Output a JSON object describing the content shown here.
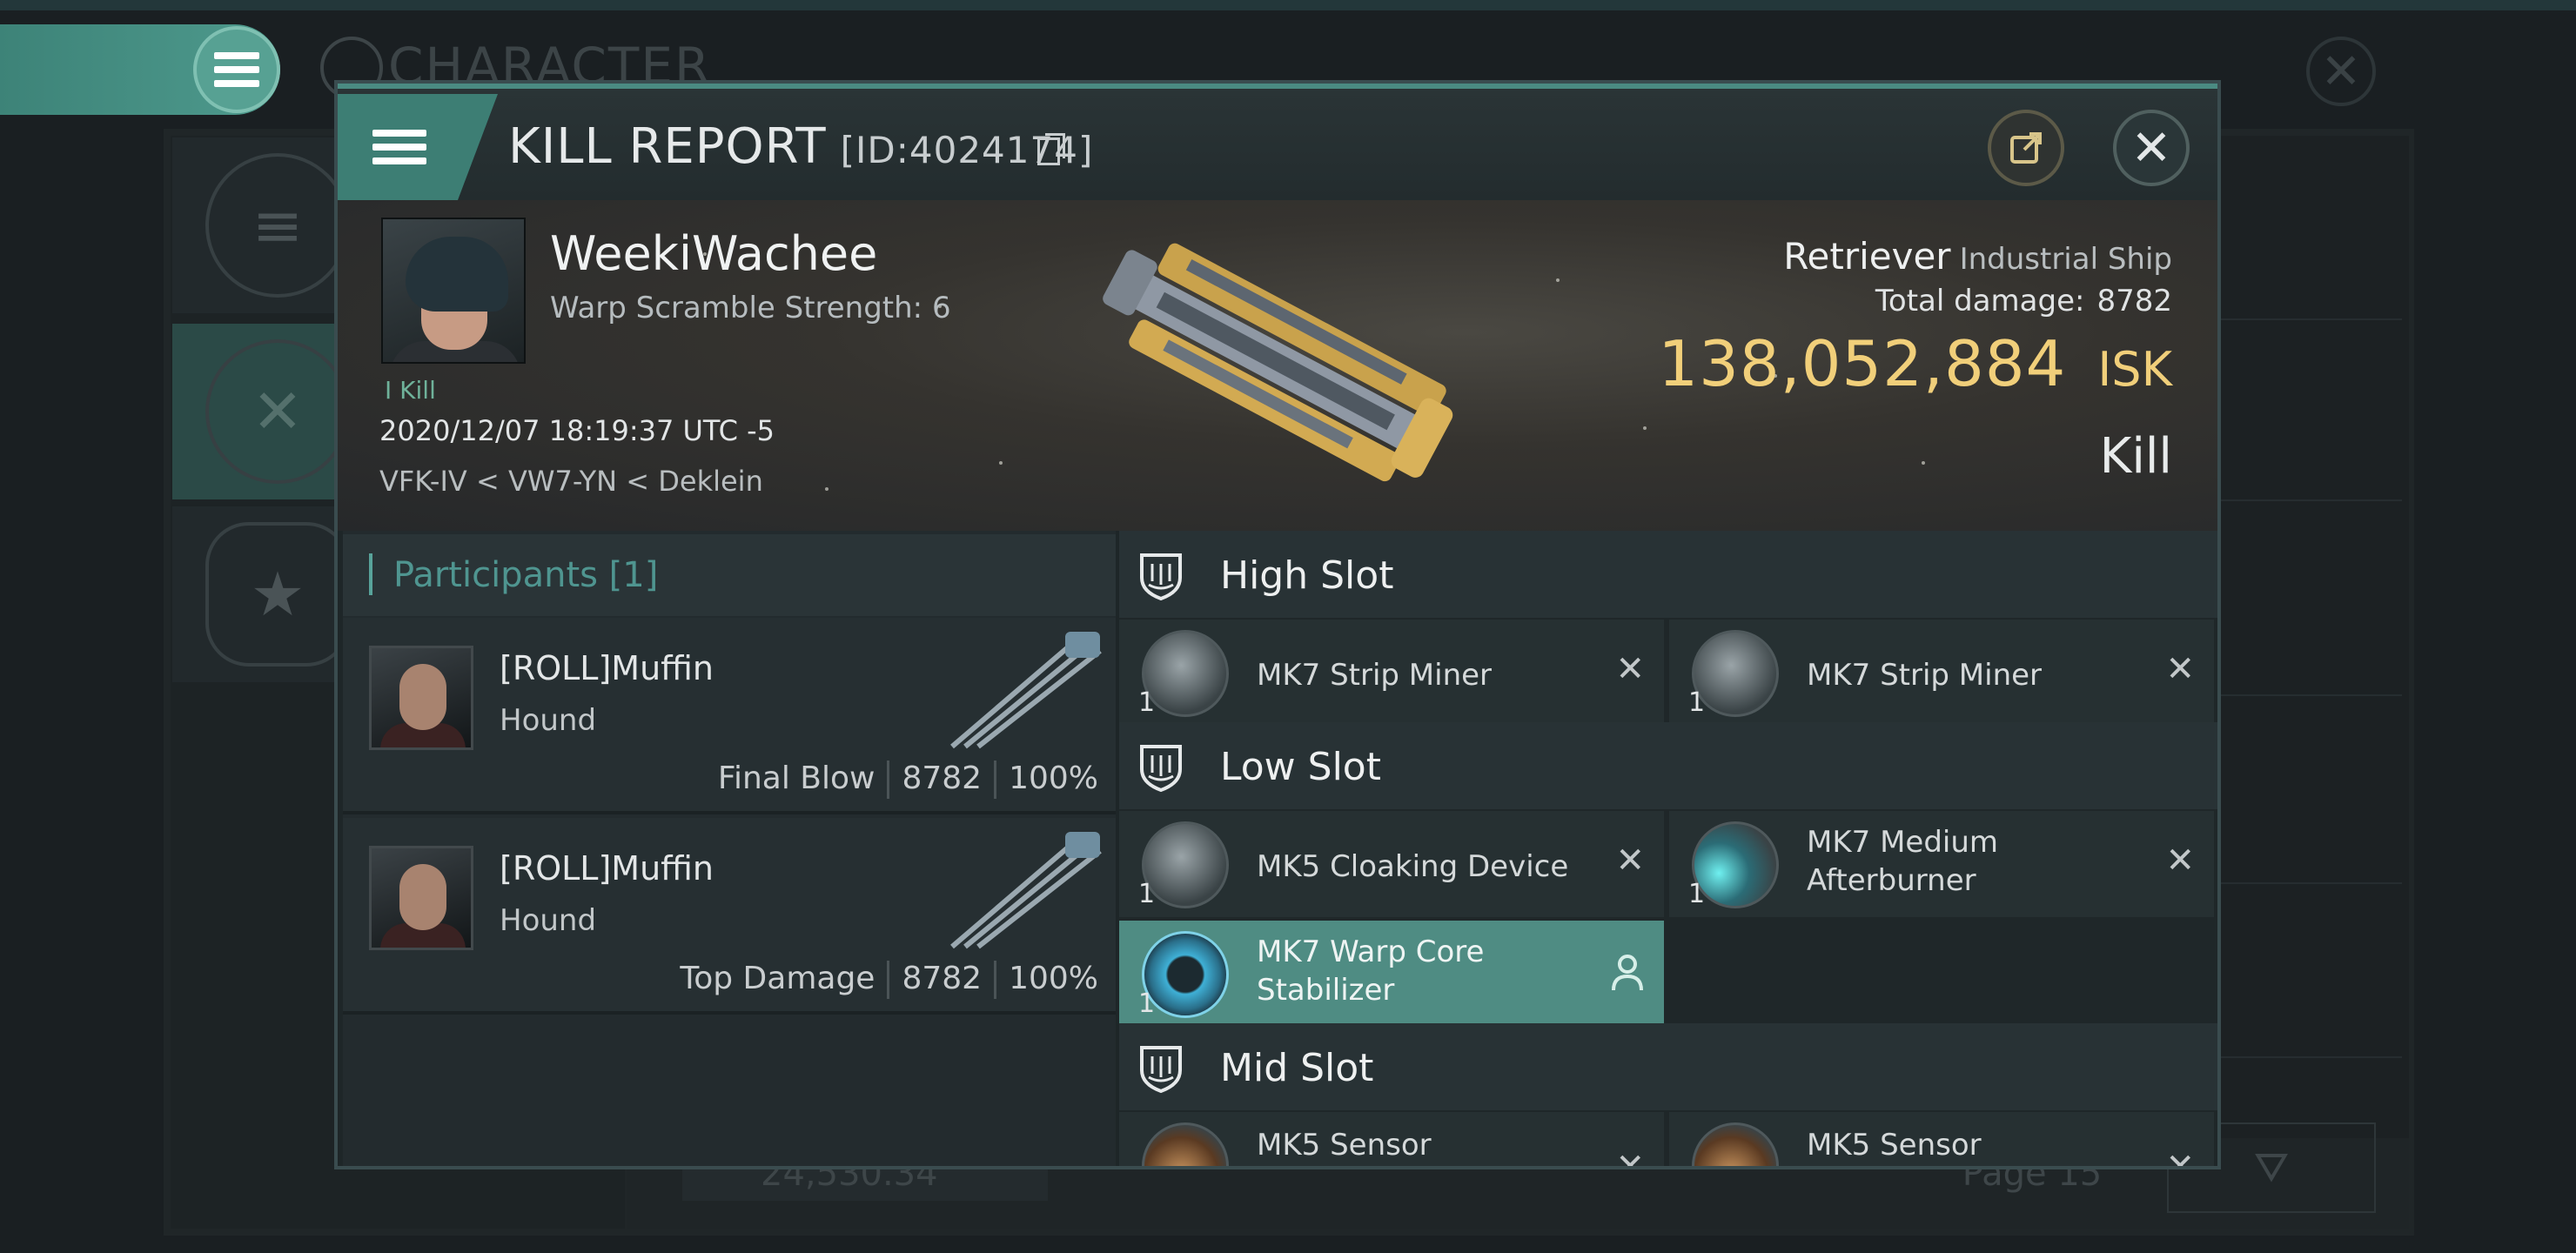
{
  "background": {
    "window_title": "CHARACTER",
    "isk_balance": "24,530.34",
    "page_label": "Page 15"
  },
  "dialog": {
    "title": "KILL REPORT",
    "id_label": "[ID:4024174]",
    "icons": {
      "menu": "hamburger-icon",
      "copy": "copy-icon",
      "share": "share-icon",
      "close": "close-icon"
    }
  },
  "victim": {
    "name": "WeekiWachee",
    "warp_scramble": "Warp Scramble Strength: 6",
    "kill_tag": "I Kill",
    "timestamp": "2020/12/07 18:19:37 UTC -5",
    "location": "VFK-IV < VW7-YN < Deklein",
    "ship_name": "Retriever",
    "ship_class": "Industrial Ship",
    "total_damage_label": "Total damage:",
    "total_damage_value": "8782",
    "isk_value": "138,052,884",
    "isk_unit": "ISK",
    "result": "Kill"
  },
  "participants": {
    "title": "Participants [1]",
    "items": [
      {
        "name": "[ROLL]Muffin",
        "ship": "Hound",
        "role": "Final Blow",
        "damage": "8782",
        "percent": "100%"
      },
      {
        "name": "[ROLL]Muffin",
        "ship": "Hound",
        "role": "Top Damage",
        "damage": "8782",
        "percent": "100%"
      }
    ]
  },
  "fitting": {
    "high_slot": {
      "label": "High Slot",
      "modules": [
        {
          "name": "MK7 Strip Miner",
          "qty": "1"
        },
        {
          "name": "MK7 Strip Miner",
          "qty": "1"
        }
      ]
    },
    "low_slot": {
      "label": "Low Slot",
      "modules": [
        {
          "name": "MK5 Cloaking Device",
          "qty": "1"
        },
        {
          "name_line1": "MK7 Medium",
          "name_line2": "Afterburner",
          "qty": "1"
        },
        {
          "name_line1": "MK7 Warp Core",
          "name_line2": "Stabilizer",
          "qty": "1"
        }
      ]
    },
    "mid_slot": {
      "label": "Mid Slot",
      "modules": [
        {
          "name": "MK5 Sensor"
        },
        {
          "name": "MK5 Sensor"
        }
      ]
    }
  },
  "colors": {
    "accent": "#4f8c83",
    "isk_gold": "#f1cf7a",
    "participants_title": "#4f9590"
  }
}
